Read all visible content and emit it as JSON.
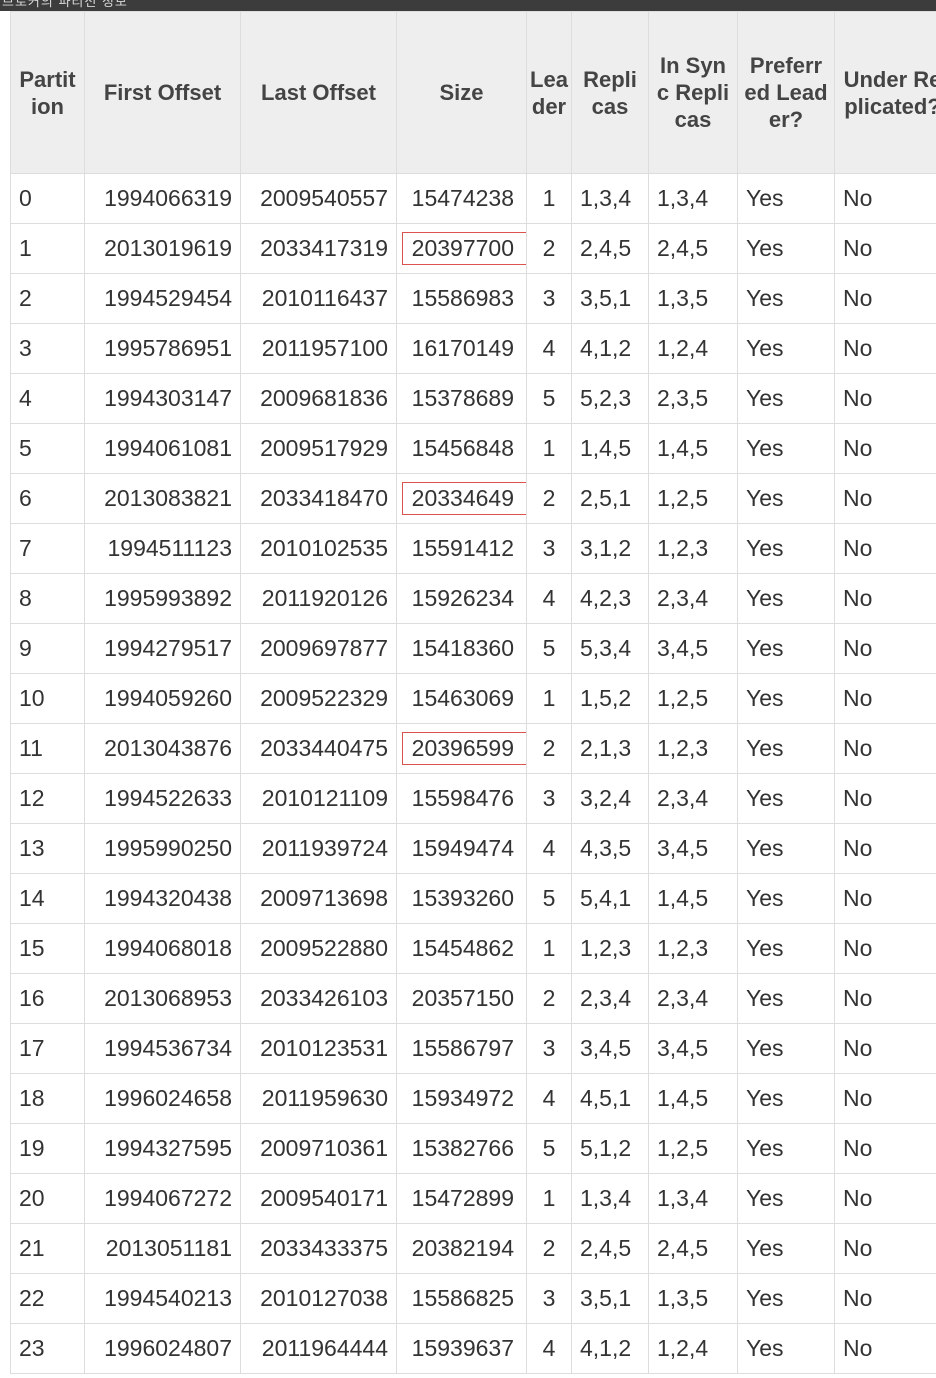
{
  "top_text": "브로커의 파티션 정보",
  "colors": {
    "header_bg": "#eeeeee",
    "border": "#dddddd",
    "highlight": "#d9534f",
    "topbar": "#3c3c3c"
  },
  "headers": [
    "Partition",
    "First Offset",
    "Last Offset",
    "Size",
    "Leader",
    "Replicas",
    "In Sync Replicas",
    "Preferred Leader?",
    "Under Replicated?"
  ],
  "rows": [
    [
      "0",
      "1994066319",
      "2009540557",
      "15474238",
      "1",
      "1,3,4",
      "1,3,4",
      "Yes",
      "No"
    ],
    [
      "1",
      "2013019619",
      "2033417319",
      "20397700",
      "2",
      "2,4,5",
      "2,4,5",
      "Yes",
      "No"
    ],
    [
      "2",
      "1994529454",
      "2010116437",
      "15586983",
      "3",
      "3,5,1",
      "1,3,5",
      "Yes",
      "No"
    ],
    [
      "3",
      "1995786951",
      "2011957100",
      "16170149",
      "4",
      "4,1,2",
      "1,2,4",
      "Yes",
      "No"
    ],
    [
      "4",
      "1994303147",
      "2009681836",
      "15378689",
      "5",
      "5,2,3",
      "2,3,5",
      "Yes",
      "No"
    ],
    [
      "5",
      "1994061081",
      "2009517929",
      "15456848",
      "1",
      "1,4,5",
      "1,4,5",
      "Yes",
      "No"
    ],
    [
      "6",
      "2013083821",
      "2033418470",
      "20334649",
      "2",
      "2,5,1",
      "1,2,5",
      "Yes",
      "No"
    ],
    [
      "7",
      "1994511123",
      "2010102535",
      "15591412",
      "3",
      "3,1,2",
      "1,2,3",
      "Yes",
      "No"
    ],
    [
      "8",
      "1995993892",
      "2011920126",
      "15926234",
      "4",
      "4,2,3",
      "2,3,4",
      "Yes",
      "No"
    ],
    [
      "9",
      "1994279517",
      "2009697877",
      "15418360",
      "5",
      "5,3,4",
      "3,4,5",
      "Yes",
      "No"
    ],
    [
      "10",
      "1994059260",
      "2009522329",
      "15463069",
      "1",
      "1,5,2",
      "1,2,5",
      "Yes",
      "No"
    ],
    [
      "11",
      "2013043876",
      "2033440475",
      "20396599",
      "2",
      "2,1,3",
      "1,2,3",
      "Yes",
      "No"
    ],
    [
      "12",
      "1994522633",
      "2010121109",
      "15598476",
      "3",
      "3,2,4",
      "2,3,4",
      "Yes",
      "No"
    ],
    [
      "13",
      "1995990250",
      "2011939724",
      "15949474",
      "4",
      "4,3,5",
      "3,4,5",
      "Yes",
      "No"
    ],
    [
      "14",
      "1994320438",
      "2009713698",
      "15393260",
      "5",
      "5,4,1",
      "1,4,5",
      "Yes",
      "No"
    ],
    [
      "15",
      "1994068018",
      "2009522880",
      "15454862",
      "1",
      "1,2,3",
      "1,2,3",
      "Yes",
      "No"
    ],
    [
      "16",
      "2013068953",
      "2033426103",
      "20357150",
      "2",
      "2,3,4",
      "2,3,4",
      "Yes",
      "No"
    ],
    [
      "17",
      "1994536734",
      "2010123531",
      "15586797",
      "3",
      "3,4,5",
      "3,4,5",
      "Yes",
      "No"
    ],
    [
      "18",
      "1996024658",
      "2011959630",
      "15934972",
      "4",
      "4,5,1",
      "1,4,5",
      "Yes",
      "No"
    ],
    [
      "19",
      "1994327595",
      "2009710361",
      "15382766",
      "5",
      "5,1,2",
      "1,2,5",
      "Yes",
      "No"
    ],
    [
      "20",
      "1994067272",
      "2009540171",
      "15472899",
      "1",
      "1,3,4",
      "1,3,4",
      "Yes",
      "No"
    ],
    [
      "21",
      "2013051181",
      "2033433375",
      "20382194",
      "2",
      "2,4,5",
      "2,4,5",
      "Yes",
      "No"
    ],
    [
      "22",
      "1994540213",
      "2010127038",
      "15586825",
      "3",
      "3,5,1",
      "1,3,5",
      "Yes",
      "No"
    ],
    [
      "23",
      "1996024807",
      "2011964444",
      "15939637",
      "4",
      "4,1,2",
      "1,2,4",
      "Yes",
      "No"
    ]
  ],
  "highlighted_partitions": [
    "1",
    "6",
    "11"
  ]
}
